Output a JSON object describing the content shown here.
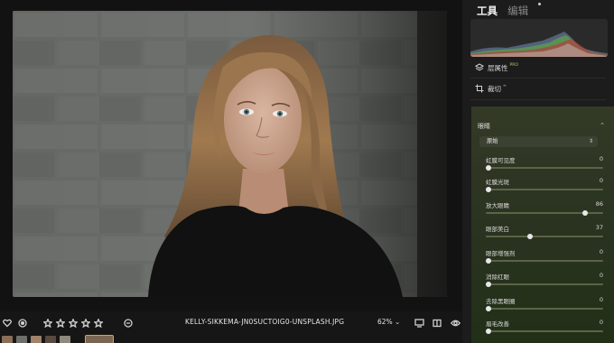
{
  "tabs": {
    "tools": "工具",
    "edit": "编辑"
  },
  "tools": [
    {
      "label": "层属性",
      "badge": "PRO",
      "icon": "layers-icon"
    },
    {
      "label": "裁切",
      "badge": "",
      "icon": "crop-icon"
    }
  ],
  "eyes": {
    "title": "眼睛",
    "preset": "原始",
    "sliders": [
      {
        "label": "虹膜可见度",
        "value": "0",
        "level": 0
      },
      {
        "label": "虹膜光斑",
        "value": "0",
        "level": 0
      },
      {
        "label": "放大眼睛",
        "value": "86",
        "level": 0.86
      },
      {
        "label": "眼部美白",
        "value": "37",
        "level": 0.37
      },
      {
        "label": "眼部增强剂",
        "value": "0",
        "level": 0
      },
      {
        "label": "消除红眼",
        "value": "0",
        "level": 0
      },
      {
        "label": "去除黑眼圈",
        "value": "0",
        "level": 0
      },
      {
        "label": "眉毛改善",
        "value": "0",
        "level": 0
      }
    ]
  },
  "bottombar": {
    "filename": "KELLY-SIKKEMA-JN0SUCTOIG0-UNSPLASH.JPG",
    "zoom": "62% ⌄",
    "rating": 0,
    "icons": [
      "heart-icon",
      "reject-icon",
      "star-icon",
      "star-icon",
      "star-icon",
      "star-icon",
      "star-icon",
      "minus-circle-icon",
      "compare-icon",
      "split-view-icon",
      "eye-icon"
    ]
  },
  "colors": {
    "accent_panel": "#2b3321",
    "accent_slider": "#5a6446",
    "pro_badge": "#b9c86a"
  }
}
